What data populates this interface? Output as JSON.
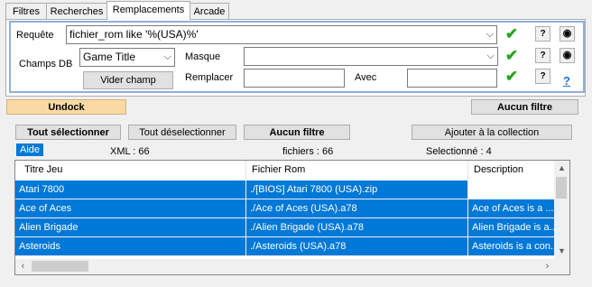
{
  "tabs": [
    "Filtres",
    "Recherches",
    "Remplacements",
    "Arcade"
  ],
  "requete": {
    "label": "Requête",
    "value": "fichier_rom like '%(USA)%'"
  },
  "champs_db": {
    "label": "Champs DB",
    "value": "Game Title"
  },
  "masque": {
    "label": "Masque",
    "value": ""
  },
  "vider_champ": "Vider champ",
  "remplacer": {
    "label": "Remplacer",
    "value": ""
  },
  "avec": {
    "label": "Avec",
    "value": ""
  },
  "help_icons": {
    "question": "?",
    "eye": "👁",
    "help": "?"
  },
  "buttons": {
    "undock": "Undock",
    "aucun_filtre_top": "Aucun filtre",
    "tout_selectionner": "Tout sélectionner",
    "tout_deselectionner": "Tout déselectionner",
    "aucun_filtre": "Aucun filtre",
    "ajouter": "Ajouter à la collection"
  },
  "status": {
    "aide": "Aide",
    "xml": "XML  :  66",
    "fichiers": "fichiers : 66",
    "selectionne": "Selectionné : 4"
  },
  "table": {
    "columns": [
      "Titre Jeu",
      "Fichier Rom",
      "Description"
    ],
    "rows": [
      [
        "Atari 7800",
        "./[BIOS] Atari 7800 (USA).zip",
        ""
      ],
      [
        "Ace of Aces",
        "./Ace of Aces (USA).a78",
        "Ace of Aces is a ..."
      ],
      [
        "Alien Brigade",
        "./Alien Brigade (USA).a78",
        "Alien Brigade is a..."
      ],
      [
        "Asteroids",
        "./Asteroids (USA).a78",
        "Asteroids is a con..."
      ]
    ]
  },
  "colors": {
    "selection": "#0078d7",
    "check": "#2aa51d",
    "undock": "#fbd9a3",
    "help_link": "#1a6fd1"
  }
}
